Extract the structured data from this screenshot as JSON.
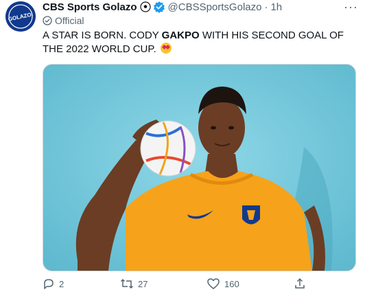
{
  "tweet": {
    "display_name": "CBS Sports Golazo",
    "handle": "@CBSSportsGolazo",
    "separator": "·",
    "time": "1h",
    "official_label": "Official",
    "text_part1": "A STAR IS BORN. CODY ",
    "text_bold": "GAKPO",
    "text_part2": " WITH HIS SECOND GOAL OF THE 2022 WORLD CUP.",
    "avatar_text": "GOLAZO!",
    "more_label": "···"
  },
  "actions": {
    "replies": "2",
    "retweets": "27",
    "likes": "160"
  },
  "colors": {
    "verified": "#1d9bf0",
    "text_secondary": "#536471",
    "media_background": "#74c9dc",
    "jersey": "#f7a21b"
  },
  "icons": [
    "soccer-ball-icon",
    "verified-badge-icon",
    "official-check-icon",
    "reply-icon",
    "retweet-icon",
    "like-icon",
    "share-icon",
    "more-icon"
  ]
}
